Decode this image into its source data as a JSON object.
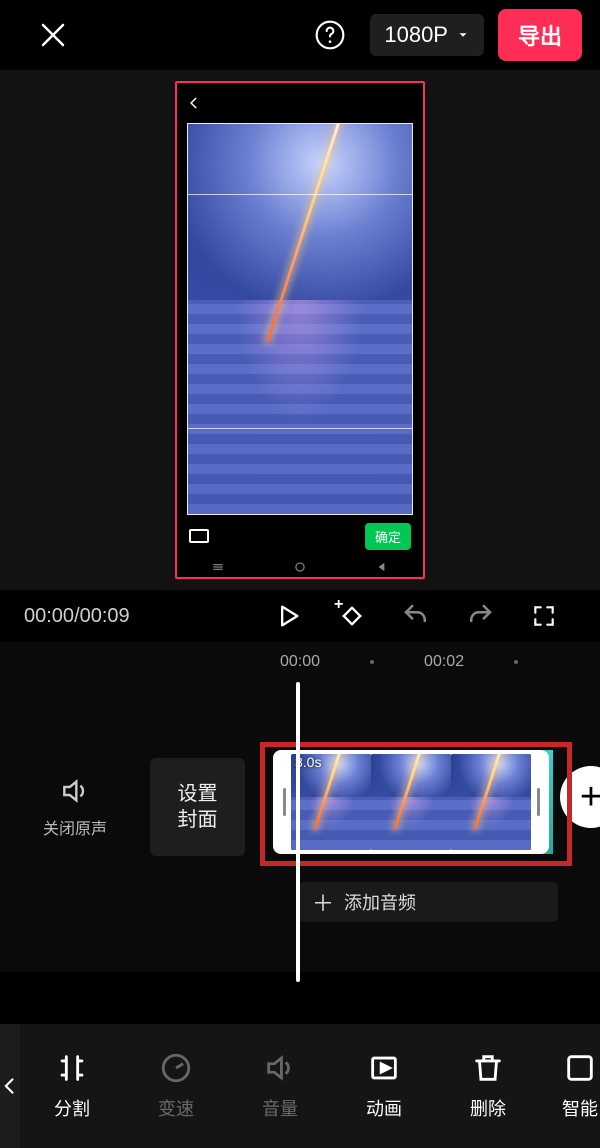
{
  "topbar": {
    "resolution": "1080P",
    "export": "导出"
  },
  "preview": {
    "confirm": "确定"
  },
  "transport": {
    "current": "00:00",
    "total": "00:09"
  },
  "timeline": {
    "ticks": [
      "00:00",
      "00:02"
    ],
    "mute_label": "关闭原声",
    "cover_button": "设置\n封面",
    "clip_duration": "3.0s",
    "add_audio": "添加音频"
  },
  "tools": {
    "split": "分割",
    "speed": "变速",
    "volume": "音量",
    "anim": "动画",
    "delete": "删除",
    "ai": "智能"
  }
}
